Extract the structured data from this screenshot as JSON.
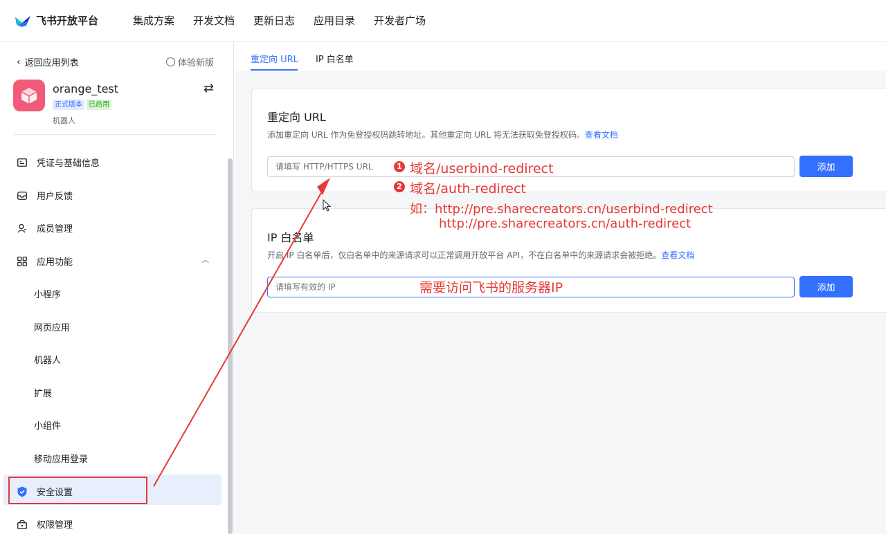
{
  "header": {
    "logo_text": "飞书开放平台",
    "nav": [
      "集成方案",
      "开发文档",
      "更新日志",
      "应用目录",
      "开发者广场"
    ]
  },
  "sidebar": {
    "back_label": "返回应用列表",
    "try_new_label": "体验新版",
    "app": {
      "name": "orange_test",
      "badge_version": "正式版本",
      "badge_status": "已启用",
      "type": "机器人"
    },
    "menu": {
      "credentials": "凭证与基础信息",
      "feedback": "用户反馈",
      "members": "成员管理",
      "features": "应用功能",
      "sub": [
        "小程序",
        "网页应用",
        "机器人",
        "扩展",
        "小组件",
        "移动应用登录"
      ],
      "security": "安全设置",
      "permissions": "权限管理"
    }
  },
  "main": {
    "tabs": [
      "重定向 URL",
      "IP 白名单"
    ],
    "redirect": {
      "title": "重定向 URL",
      "desc": "添加重定向 URL 作为免登授权码跳转地址。其他重定向 URL 将无法获取免登授权码。",
      "link": "查看文档",
      "placeholder": "请填写 HTTP/HTTPS URL",
      "button": "添加"
    },
    "ip": {
      "title": "IP 白名单",
      "desc": "开启 IP 白名单后，仅白名单中的来源请求可以正常调用开放平台 API，不在白名单中的来源请求会被拒绝。",
      "link": "查看文档",
      "placeholder": "请填写有效的 IP",
      "button": "添加"
    }
  },
  "annotations": {
    "num1": "1",
    "item1": "域名/userbind-redirect",
    "num2": "2",
    "item2": "域名/auth-redirect",
    "example_line1": "如：http://pre.sharecreators.cn/userbind-redirect",
    "example_line2": "http://pre.sharecreators.cn/auth-redirect",
    "ip_note": "需要访问飞书的服务器IP",
    "color": "#e53935"
  },
  "colors": {
    "accent": "#3370ff",
    "app_icon": "#f25a7a"
  }
}
